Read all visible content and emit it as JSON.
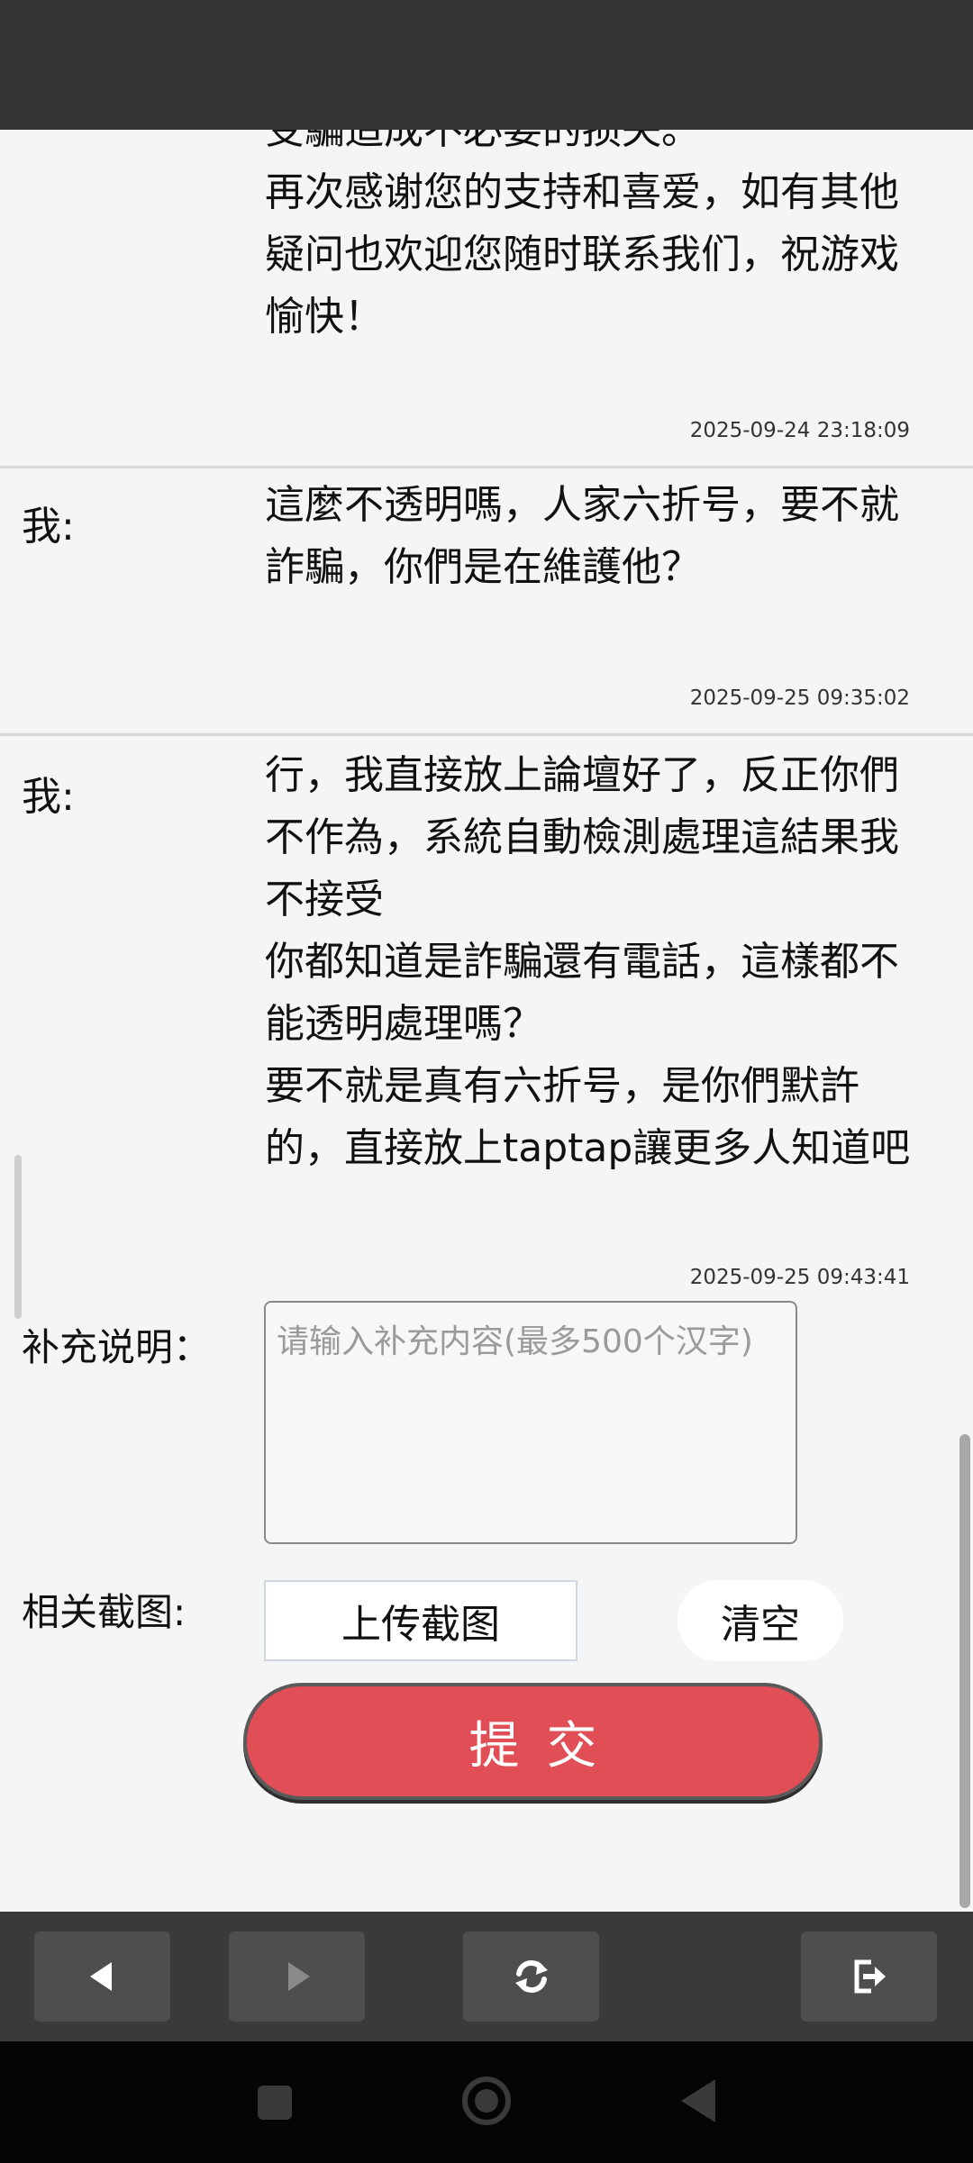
{
  "messages": [
    {
      "sender": "",
      "partial_line": "受騙造成不必要的损失。",
      "text": "再次感谢您的支持和喜爱，如有其他\n疑问也欢迎您随时联系我们，祝游戏\n愉快！",
      "time": "2025-09-24 23:18:09"
    },
    {
      "sender": "我:",
      "text": "這麼不透明嗎，人家六折号，要不就\n詐騙，你們是在維護他？",
      "time": "2025-09-25 09:35:02"
    },
    {
      "sender": "我:",
      "text": "行，我直接放上論壇好了，反正你們\n不作為，系統自動檢測處理這結果我\n不接受\n你都知道是詐騙還有電話，這樣都不\n能透明處理嗎？\n要不就是真有六折号，是你們默許\n的，直接放上taptap讓更多人知道吧",
      "time": "2025-09-25 09:43:41"
    }
  ],
  "form": {
    "supplement_label": "补充说明：",
    "supplement_placeholder": "请输入补充内容(最多500个汉字)",
    "screenshot_label": "相关截图:",
    "upload_label": "上传截图",
    "clear_label": "清空",
    "submit_label": "提交"
  },
  "colors": {
    "submit": "#e24e55",
    "toolbar": "#3a3a3a",
    "status_bar": "#353535"
  },
  "toolbar_icons": [
    "back-arrow-icon",
    "forward-arrow-icon",
    "refresh-icon",
    "exit-icon"
  ],
  "system_nav_icons": [
    "square-icon",
    "circle-icon",
    "triangle-back-icon"
  ]
}
